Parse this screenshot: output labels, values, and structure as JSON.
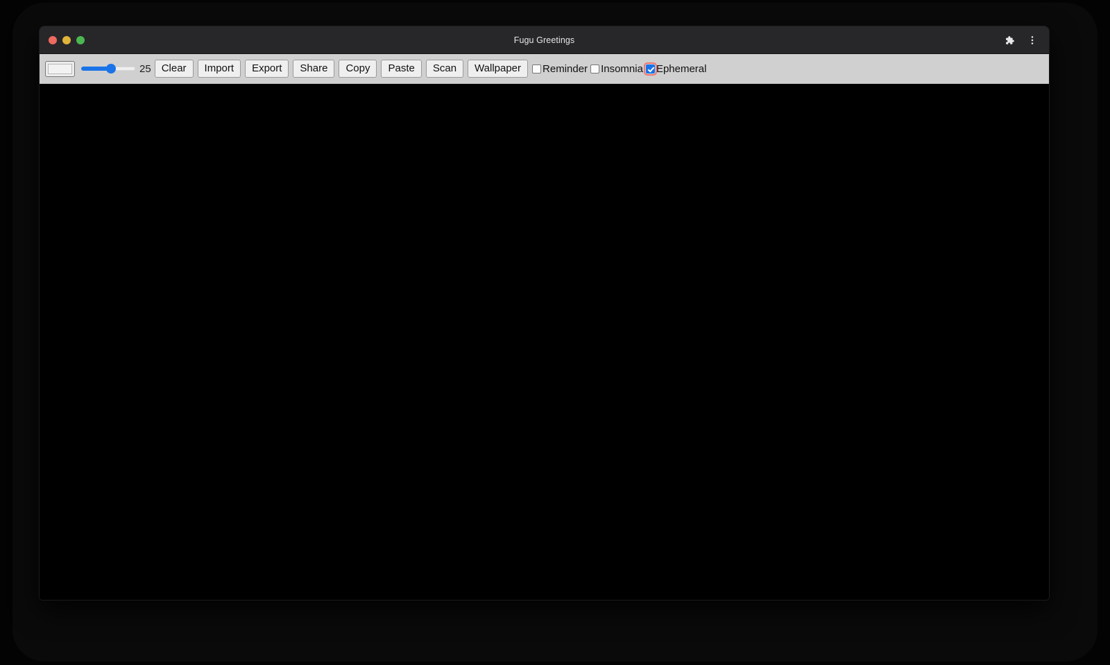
{
  "window": {
    "title": "Fugu Greetings",
    "traffic_lights": [
      {
        "name": "close",
        "color": "#ed6a5e"
      },
      {
        "name": "minimize",
        "color": "#e0b43a"
      },
      {
        "name": "maximize",
        "color": "#4cb750"
      }
    ],
    "titlebar_actions": [
      {
        "icon": "extensions-puzzle-icon"
      },
      {
        "icon": "more-vertical-menu-icon"
      }
    ],
    "titlebar_bg": "#27272a"
  },
  "toolbar": {
    "background": "#d0d0d0",
    "color_picker": {
      "label": "color-picker",
      "value": "#f2f2f2"
    },
    "slider": {
      "label": "line-width-slider",
      "value": "25",
      "min": "1",
      "max": "50",
      "percent": 55,
      "accent": "#1a73e8"
    },
    "slider_value_display": "25",
    "buttons": [
      {
        "label": "Clear"
      },
      {
        "label": "Import"
      },
      {
        "label": "Export"
      },
      {
        "label": "Share"
      },
      {
        "label": "Copy"
      },
      {
        "label": "Paste"
      },
      {
        "label": "Scan"
      },
      {
        "label": "Wallpaper"
      }
    ],
    "checkboxes": [
      {
        "label": "Reminder",
        "checked": false,
        "focused": false
      },
      {
        "label": "Insomnia",
        "checked": false,
        "focused": false
      },
      {
        "label": "Ephemeral",
        "checked": true,
        "focused": true,
        "focus_color": "#f2776f"
      }
    ]
  },
  "canvas": {
    "name": "drawing-canvas",
    "background": "#000000"
  }
}
